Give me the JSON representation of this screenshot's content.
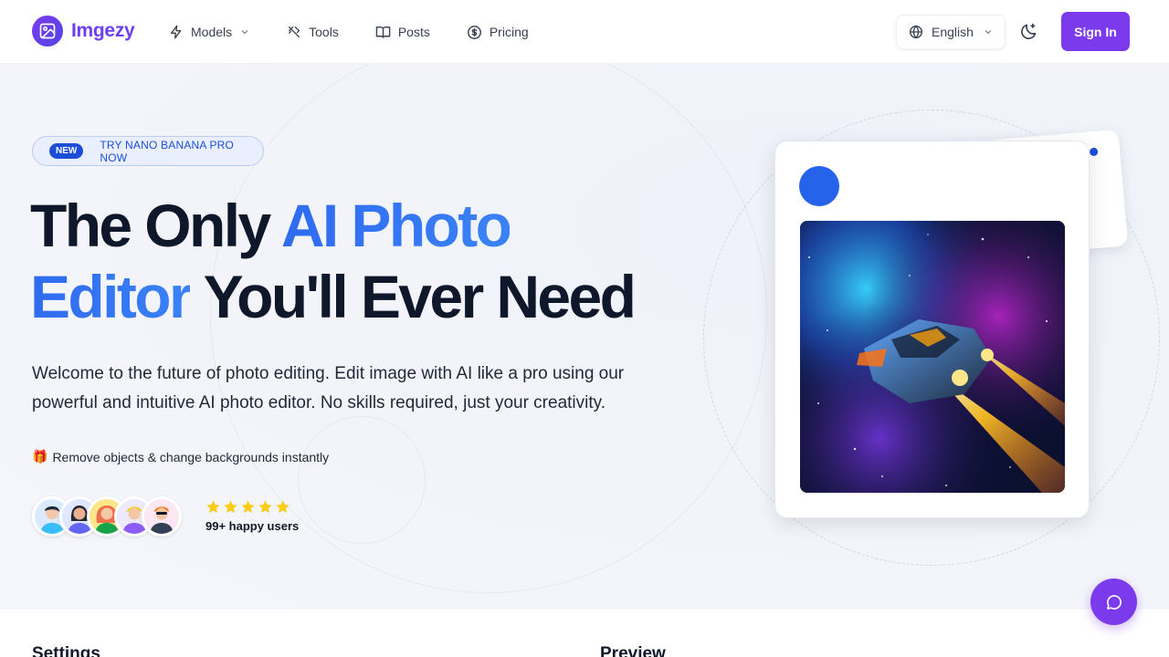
{
  "brand": {
    "name": "Imgezy"
  },
  "nav": {
    "links": [
      {
        "label": "Models",
        "icon": "bolt-icon",
        "dropdown": true
      },
      {
        "label": "Tools",
        "icon": "tools-icon",
        "dropdown": false
      },
      {
        "label": "Posts",
        "icon": "book-icon",
        "dropdown": false
      },
      {
        "label": "Pricing",
        "icon": "dollar-circle-icon",
        "dropdown": false
      }
    ],
    "language": "English",
    "signin_label": "Sign In"
  },
  "hero": {
    "badge_tag": "NEW",
    "badge_text": "TRY NANO BANANA PRO NOW",
    "headline": {
      "part1": "The Only ",
      "highlight1": "AI Photo",
      "highlight2": "Editor",
      "part2": " You'll Ever Need"
    },
    "subtitle": "Welcome to the future of photo editing. Edit image with AI like a pro using our powerful and intuitive AI photo editor. No skills required, just your creativity.",
    "feature_emoji": "🎁",
    "feature_text": "Remove objects & change backgrounds instantly",
    "rating_stars": 5,
    "happy_users": "99+ happy users"
  },
  "sections": {
    "settings_title": "Settings",
    "preview_title": "Preview"
  },
  "colors": {
    "brand": "#7c3aed",
    "accent_blue": "#2563eb",
    "star": "#facc15"
  }
}
